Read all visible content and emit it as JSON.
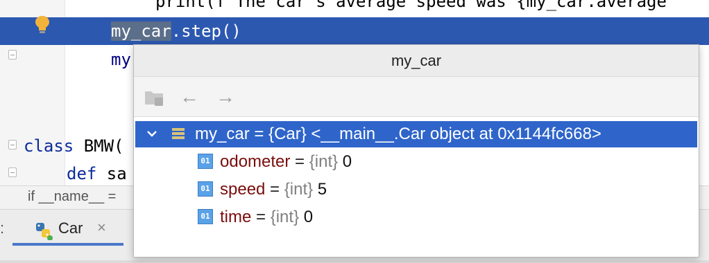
{
  "editor": {
    "line_print": "print(f\"The car's average speed was {my_car.average",
    "line_step_var": "my_car",
    "line_step_rest": ".step()",
    "line_my": "my",
    "line_class_kw": "class",
    "line_class_rest": " BMW(",
    "line_def_kw": "def",
    "line_def_rest": " sa"
  },
  "crumb": {
    "text": "if __name__ ="
  },
  "tabs": {
    "colon": ":",
    "active_label": "Car",
    "close_glyph": "×"
  },
  "popup": {
    "title": "my_car",
    "back_arrow": "←",
    "forward_arrow": "→",
    "tree": {
      "root": {
        "name": "my_car",
        "eq": " = ",
        "type": "{Car}",
        "value": " <__main__.Car object at 0x1144fc668>"
      },
      "children": [
        {
          "icon": "01",
          "name": "odometer",
          "eq": " = ",
          "type": "{int}",
          "value": " 0"
        },
        {
          "icon": "01",
          "name": "speed",
          "eq": " = ",
          "type": "{int}",
          "value": " 5"
        },
        {
          "icon": "01",
          "name": "time",
          "eq": " = ",
          "type": "{int}",
          "value": " 0"
        }
      ]
    }
  },
  "colors": {
    "line_highlight": "#2c58b0",
    "tree_selected": "#2f65ca",
    "var_name": "#7a0d0d",
    "keyword": "#0c2c9c",
    "int_icon": "#5aa2e8"
  },
  "icons": {
    "bulb": "lightbulb-icon",
    "folder": "folder-icon",
    "expand": "chevron-down-icon",
    "object": "object-fields-icon",
    "int": "int-type-icon",
    "python": "python-icon"
  }
}
